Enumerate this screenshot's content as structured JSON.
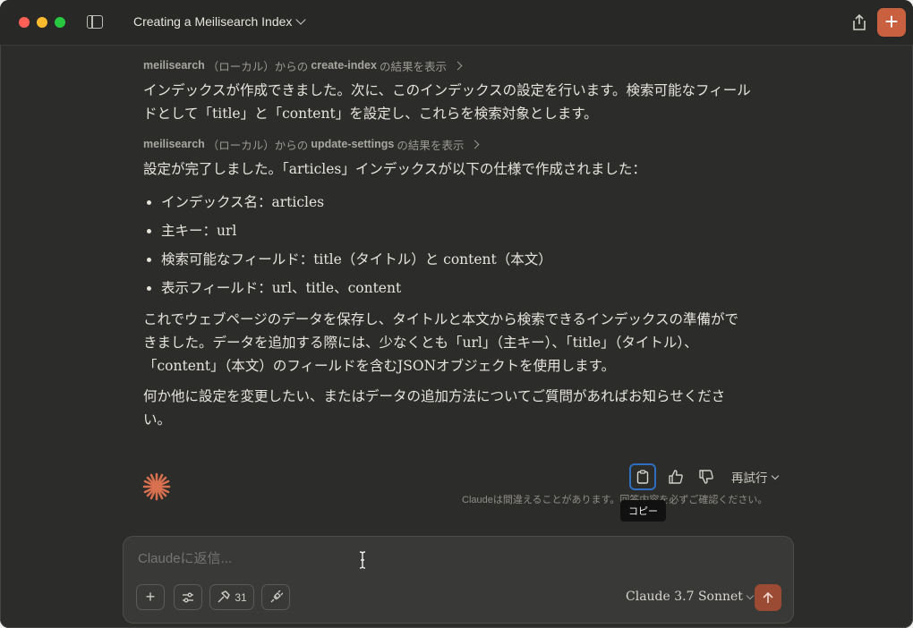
{
  "header": {
    "title": "Creating a Meilisearch Index"
  },
  "messages": {
    "tool1": {
      "server": "meilisearch",
      "scope": "（ローカル）からの",
      "tool": "create-index",
      "suffix": "の結果を表示"
    },
    "para1": "インデックスが作成できました。次に、このインデックスの設定を行います。検索可能なフィールドとして「title」と「content」を設定し、これらを検索対象とします。",
    "tool2": {
      "server": "meilisearch",
      "scope": "（ローカル）からの",
      "tool": "update-settings",
      "suffix": "の結果を表示"
    },
    "para2": "設定が完了しました。「articles」インデックスが以下の仕様で作成されました：",
    "bullets": [
      "インデックス名：articles",
      "主キー：url",
      "検索可能なフィールド：title（タイトル）と content（本文）",
      "表示フィールド：url、title、content"
    ],
    "para3": "これでウェブページのデータを保存し、タイトルと本文から検索できるインデックスの準備ができました。データを追加する際には、少なくとも「url」（主キー）、「title」（タイトル）、「content」（本文）のフィールドを含むJSONオブジェクトを使用します。",
    "para4": "何か他に設定を変更したい、またはデータの追加方法についてご質問があればお知らせください。"
  },
  "actions": {
    "retry_label": "再試行",
    "disclaimer": "Claudeは間違えることがあります。回答内容を必ずご確認ください。",
    "tooltip": "コピー"
  },
  "composer": {
    "placeholder": "Claudeに返信...",
    "tools_count": "31",
    "model": "Claude 3.7 Sonnet"
  },
  "colors": {
    "accent": "#c9603f",
    "send": "#9b4a33",
    "focus": "#2f6fbf"
  }
}
